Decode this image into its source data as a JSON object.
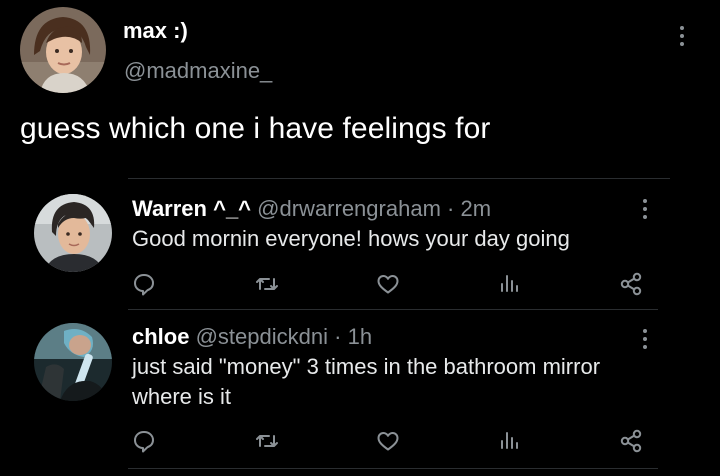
{
  "main_tweet": {
    "display_name": "max :)",
    "handle": "@madmaxine_",
    "text": "guess which one i have feelings for"
  },
  "replies": [
    {
      "display_name": "Warren ^_^",
      "handle": "@drwarrengraham",
      "separator": "·",
      "time": "2m",
      "text": "Good mornin everyone! hows your day going"
    },
    {
      "display_name": "chloe",
      "handle": "@stepdickdni",
      "separator": "·",
      "time": "1h",
      "text": "just said \"money\" 3 times in the bathroom mirror where is it"
    }
  ],
  "icons": [
    "comment-icon",
    "retweet-icon",
    "like-icon",
    "views-icon",
    "share-icon",
    "more-icon"
  ],
  "colors": {
    "background": "#000000",
    "primary_text": "#ffffff",
    "secondary_text": "#8b9196",
    "divider": "#2a2d30"
  }
}
